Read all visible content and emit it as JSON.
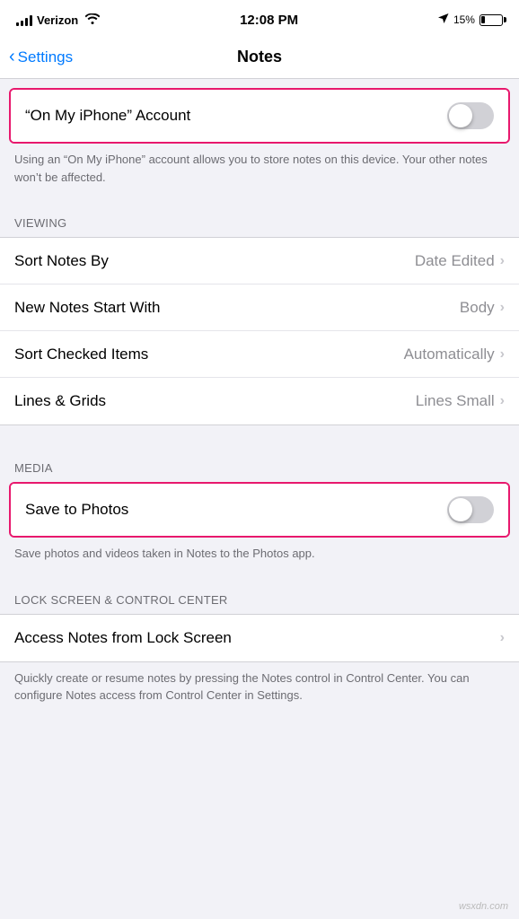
{
  "statusBar": {
    "carrier": "Verizon",
    "time": "12:08 PM",
    "batteryPercent": "15%"
  },
  "navBar": {
    "backLabel": "Settings",
    "title": "Notes"
  },
  "sections": {
    "onMyIphone": {
      "rowLabel": "“On My iPhone” Account",
      "description": "Using an “On My iPhone” account allows you to store notes on this device. Your other notes won’t be affected."
    },
    "viewing": {
      "header": "VIEWING",
      "rows": [
        {
          "label": "Sort Notes By",
          "value": "Date Edited"
        },
        {
          "label": "New Notes Start With",
          "value": "Body"
        },
        {
          "label": "Sort Checked Items",
          "value": "Automatically"
        },
        {
          "label": "Lines & Grids",
          "value": "Lines Small"
        }
      ]
    },
    "media": {
      "header": "MEDIA",
      "rowLabel": "Save to Photos",
      "description": "Save photos and videos taken in Notes to the Photos app."
    },
    "lockScreen": {
      "header": "LOCK SCREEN & CONTROL CENTER",
      "rowLabel": "Access Notes from Lock Screen",
      "description": "Quickly create or resume notes by pressing the Notes control in Control Center. You can configure Notes access from Control Center in Settings."
    }
  },
  "icons": {
    "chevronRight": "›",
    "backChevron": "‹"
  }
}
